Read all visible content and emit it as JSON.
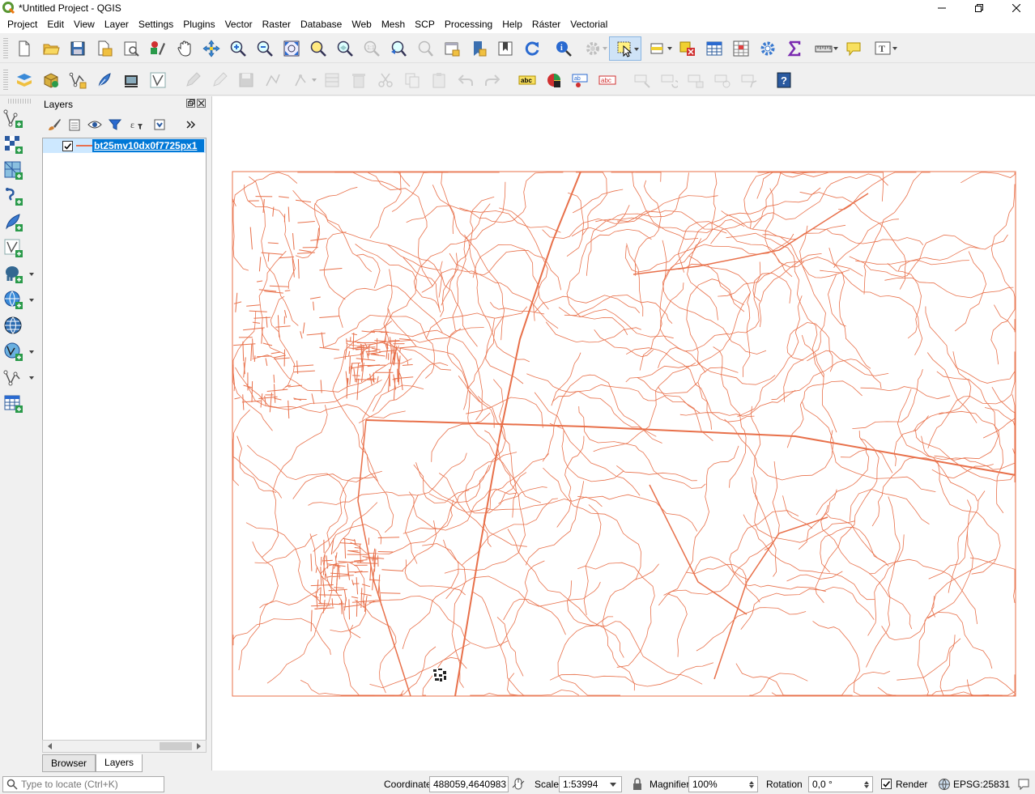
{
  "window": {
    "title": "*Untitled Project - QGIS",
    "controls": [
      "minimize",
      "restore",
      "close"
    ]
  },
  "menu": [
    "Project",
    "Edit",
    "View",
    "Layer",
    "Settings",
    "Plugins",
    "Vector",
    "Raster",
    "Database",
    "Web",
    "Mesh",
    "SCP",
    "Processing",
    "Help",
    "Ráster",
    "Vectorial"
  ],
  "layers_panel": {
    "title": "Layers",
    "layers": [
      {
        "name": "bt25mv10dx0f7725px1",
        "checked": true,
        "color": "#e87050"
      }
    ],
    "tabs": [
      "Browser",
      "Layers"
    ],
    "active_tab": "Layers"
  },
  "map": {
    "line_color": "#e8704a"
  },
  "status": {
    "locate_placeholder": "Type to locate (Ctrl+K)",
    "coordinate_label": "Coordinate",
    "coordinate_value": "488059,4640983",
    "scale_label": "Scale",
    "scale_value": "1:53994",
    "magnifier_label": "Magnifier",
    "magnifier_value": "100%",
    "rotation_label": "Rotation",
    "rotation_value": "0,0 °",
    "render_label": "Render",
    "render_checked": true,
    "crs": "EPSG:25831"
  }
}
